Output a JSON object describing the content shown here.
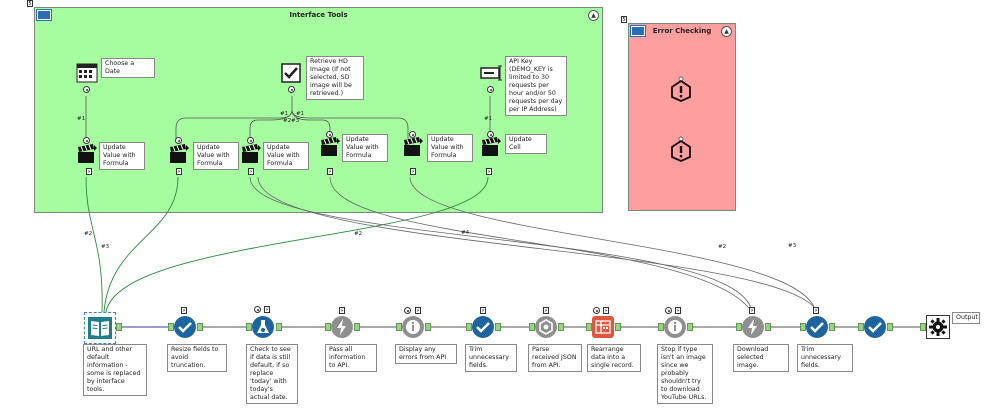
{
  "canvas_marker": "5",
  "containers": {
    "interface_tools": {
      "title": "Interface Tools",
      "collapse": "▲"
    },
    "error_checking": {
      "marker": "5",
      "title": "Error Checking",
      "collapse": "▲"
    }
  },
  "interface_notes": {
    "choose_date": "Choose a Date",
    "retrieve_hd": "Retrieve HD Image (If not selected, SD image will be retrieved.)",
    "api_key": "API Key (DEMO_KEY is limited to 30 requests per hour and/or 50 requests per day per IP Address)",
    "update_1": "Update Value with Formula",
    "update_2": "Update Value with Formula",
    "update_3": "Update Value with Formula",
    "update_4": "Update Value with Formula",
    "update_5": "Update Value with Formula",
    "update_cell": "Update Cell"
  },
  "connection_labels": {
    "date_out": "#1",
    "hd_out_a": "#1",
    "hd_out_b": "#1",
    "hd_out_c": "#2",
    "hd_out_d": "#3",
    "api_out": "#1",
    "w2a": "#2",
    "w3a": "#3",
    "w2b": "#2",
    "w4": "#4",
    "w2c": "#2",
    "w3b": "#3"
  },
  "workflow_notes": {
    "url_info": "URL and other default information - some is replaced by interface tools.",
    "resize": "Resize fields to avoid truncation.",
    "check_default": "Check to see if data is still default, if so replace 'today' with today's actual date.",
    "pass_all": "Pass all information to API.",
    "display_errors": "Display any errors from API",
    "trim_1": "Trim unnecessary fields.",
    "parse_json": "Parse received JSON from API.",
    "rearrange": "Rearrange data into a single record.",
    "stop_type": "Stop if type isn't an image since we probably shouldn't try to download YouTube URLs.",
    "download": "Download selected image.",
    "trim_2": "Trim unnecessary fields.",
    "output": "Output"
  },
  "icons": {
    "text_input": "book-icon",
    "select": "checkmark-icon",
    "formula": "flask-icon",
    "download": "lightning-icon",
    "message": "info-icon",
    "json_parse": "gear-hex-icon",
    "cross_tab": "crosstab-icon",
    "output": "gear-icon",
    "error": "exclamation-icon",
    "update": "clapperboard-icon"
  },
  "colors": {
    "interface_container": "#a5fda0",
    "error_container": "#ff9e9e",
    "select_tool": "#1e64a0",
    "gray_tool": "#8f8f8f",
    "crosstab_tool": "#e0573f",
    "selected_border": "#3a7fd0"
  }
}
